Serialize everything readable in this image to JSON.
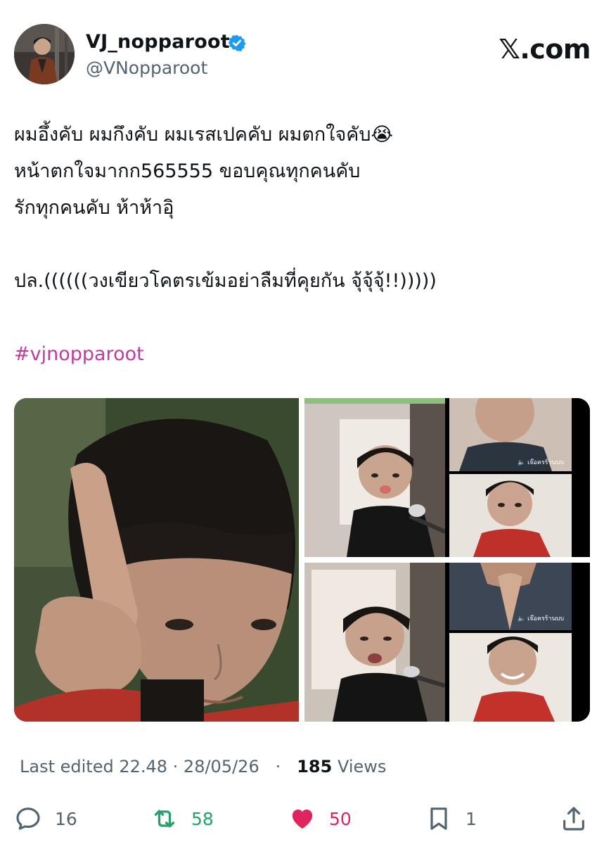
{
  "author": {
    "display_name": "VJ_nopparoot",
    "handle": "@VNopparoot",
    "verified": true,
    "verified_color": "#1d9bf0"
  },
  "brand": "𝕏.com",
  "tweet": {
    "lines": [
      "ผมอึ้งคับ ผมกึงคับ ผมเรสเปคคับ ผมตกใจคับ😭",
      "หน้าตกใจมากก565555 ขอบคุณทุกคนคับ",
      "รักทุกคนคับ ห้าห้าอิุ",
      "",
      "ปล.((((((วงเขียวโคตรเข้มอย่าลืมที่คุยกัน จุ้จุ้จุ้!!)))))",
      ""
    ],
    "hashtag": "#vjnopparoot",
    "hashtag_color": "#c23ba1"
  },
  "media": {
    "pip_label_top": "🔈 เจ๊อครร้านบบ",
    "pip_label_bottom": "🔈 เจ๊อครร้านบบ"
  },
  "meta": {
    "edited": "Last edited 22.48 · 28/05/26",
    "separator": "·",
    "views_count": "185",
    "views_label": "Views"
  },
  "actions": {
    "reply": {
      "icon": "reply-icon",
      "count": "16"
    },
    "repost": {
      "icon": "repost-icon",
      "count": "58",
      "color": "#27a16a"
    },
    "like": {
      "icon": "heart-icon",
      "count": "50",
      "color": "#e0245e"
    },
    "bookmark": {
      "icon": "bookmark-icon",
      "count": "1"
    },
    "share": {
      "icon": "share-icon"
    }
  }
}
